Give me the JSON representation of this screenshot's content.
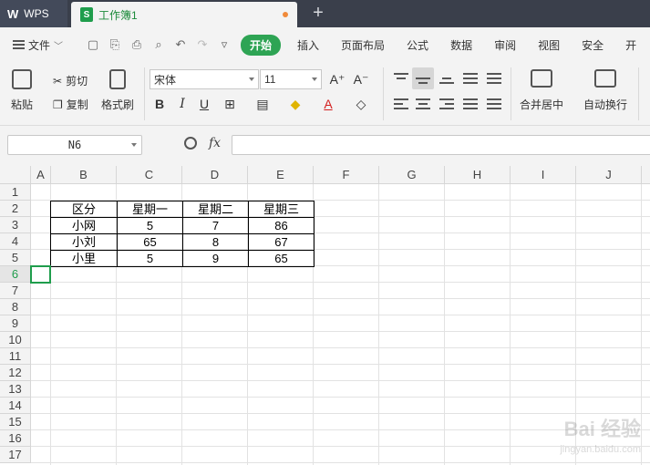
{
  "titlebar": {
    "app_label": "WPS",
    "doc_tab_title": "工作簿1",
    "new_tab_glyph": "+"
  },
  "menubar": {
    "file_label": "文件",
    "items": [
      "开始",
      "插入",
      "页面布局",
      "公式",
      "数据",
      "审阅",
      "视图",
      "安全",
      "开"
    ]
  },
  "ribbon": {
    "paste": "粘贴",
    "cut": "剪切",
    "copy": "复制",
    "format_painter": "格式刷",
    "font_name": "宋体",
    "font_size": "11",
    "merge_center": "合并居中",
    "wrap_text": "自动换行"
  },
  "formula_bar": {
    "cell_ref": "N6",
    "fx": "fx",
    "formula": ""
  },
  "sheet": {
    "columns": [
      "A",
      "B",
      "C",
      "D",
      "E",
      "F",
      "G",
      "H",
      "I",
      "J"
    ],
    "rows": [
      "1",
      "2",
      "3",
      "4",
      "5",
      "6",
      "7",
      "8",
      "9",
      "10",
      "11",
      "12",
      "13",
      "14",
      "15",
      "16",
      "17"
    ],
    "active_row": "6",
    "table_header": [
      "区分",
      "星期一",
      "星期二",
      "星期三"
    ],
    "table_rows": [
      [
        "小网",
        "5",
        "7",
        "86"
      ],
      [
        "小刘",
        "65",
        "8",
        "67"
      ],
      [
        "小里",
        "5",
        "9",
        "65"
      ]
    ]
  },
  "watermark": {
    "text": "Bai 经验",
    "url": "jingyan.baidu.com"
  },
  "colors": {
    "accent": "#2ea454",
    "titlebar": "#3a3f4b",
    "ribbon_bg": "#f3f3f3"
  }
}
